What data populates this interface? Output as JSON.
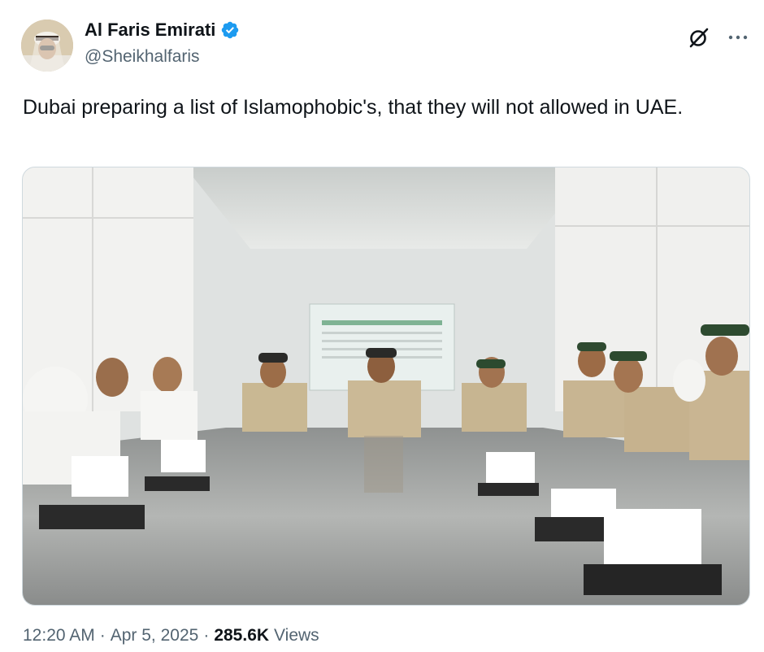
{
  "author": {
    "display_name": "Al Faris Emirati",
    "handle": "@Sheikhalfaris",
    "verified": true,
    "verified_color": "#1d9bf0"
  },
  "icons": {
    "grok": "grok-icon",
    "more": "more-icon",
    "verified": "verified-badge-icon"
  },
  "tweet": {
    "text": "Dubai preparing a list of Islamophobic's, that they will not allowed in UAE."
  },
  "meta": {
    "time": "12:20 AM",
    "dot1": "·",
    "date": "Apr 5, 2025",
    "dot2": "·",
    "views_count": "285.6K",
    "views_label": "Views"
  },
  "colors": {
    "text": "#0f1419",
    "secondary": "#536471",
    "border": "#cfd9de"
  }
}
